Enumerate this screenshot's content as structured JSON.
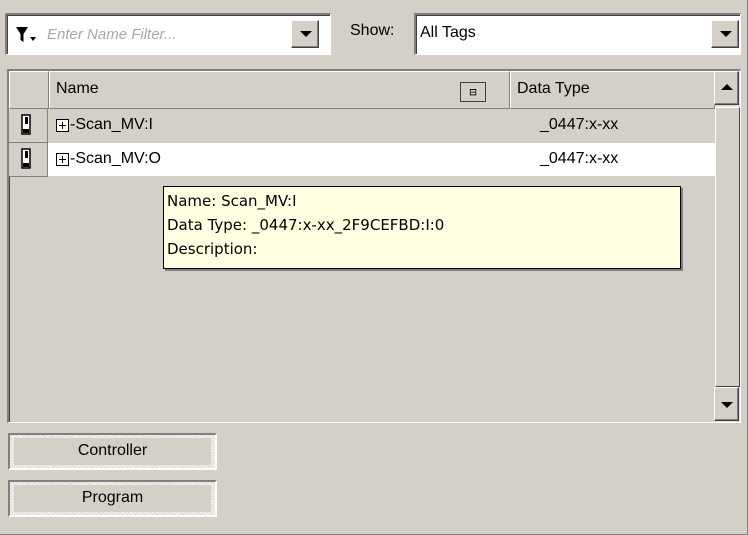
{
  "filter": {
    "placeholder": "Enter Name Filter...",
    "icon": "funnel-icon"
  },
  "show": {
    "label": "Show:",
    "selected": "All Tags"
  },
  "grid": {
    "columns": [
      {
        "label": "Name"
      },
      {
        "label": "Data Type"
      }
    ],
    "column_chooser_glyph": "⁻⁄₈",
    "rows": [
      {
        "expand": "+",
        "name": "Scan_MV:I",
        "type": "_0447:x-xx"
      },
      {
        "expand": "+",
        "name": "Scan_MV:O",
        "type": "_0447:x-xx"
      }
    ]
  },
  "tooltip": {
    "line1": "Name: Scan_MV:I",
    "line2": "Data Type: _0447:x-xx_2F9CEFBD:I:0",
    "line3": "Description:",
    "background": "#ffffe1"
  },
  "tabs": [
    {
      "label": "Controller"
    },
    {
      "label": "Program"
    }
  ],
  "colors": {
    "face": "#d4d0c8",
    "window": "#ffffff",
    "placeholder": "#a8a8a8"
  }
}
